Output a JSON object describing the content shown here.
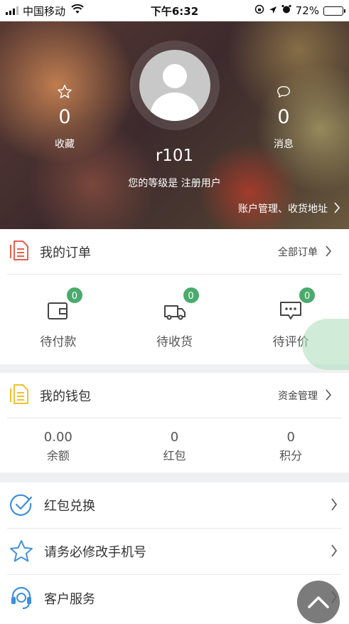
{
  "status_bar": {
    "carrier": "中国移动",
    "time": "下午6:32",
    "battery": "72%",
    "battery_level": 0.72
  },
  "profile": {
    "favorites": {
      "icon": "star-icon",
      "count": "0",
      "label": "收藏"
    },
    "messages": {
      "icon": "chat-bubble-icon",
      "count": "0",
      "label": "消息"
    },
    "username": "r101",
    "level_text": "您的等级是 注册用户",
    "account_link": "账户管理、收货地址"
  },
  "orders": {
    "title": "我的订单",
    "all_link": "全部订单",
    "items": [
      {
        "icon": "wallet-icon",
        "badge": "0",
        "label": "待付款"
      },
      {
        "icon": "truck-icon",
        "badge": "0",
        "label": "待收货"
      },
      {
        "icon": "comment-icon",
        "badge": "0",
        "label": "待评价"
      }
    ]
  },
  "wallet": {
    "title": "我的钱包",
    "manage_link": "资金管理",
    "items": [
      {
        "value": "0.00",
        "label": "余额"
      },
      {
        "value": "0",
        "label": "红包"
      },
      {
        "value": "0",
        "label": "积分"
      }
    ]
  },
  "menu": [
    {
      "icon": "check-circle-icon",
      "label": "红包兑换"
    },
    {
      "icon": "star-outline-icon",
      "label": "请务必修改手机号"
    },
    {
      "icon": "headset-icon",
      "label": "客户服务"
    }
  ],
  "colors": {
    "badge_green": "#4aab6d",
    "order_icon_red": "#e8604c",
    "wallet_icon_yellow": "#f2c12e",
    "menu_icon_blue": "#3d8fe0"
  }
}
